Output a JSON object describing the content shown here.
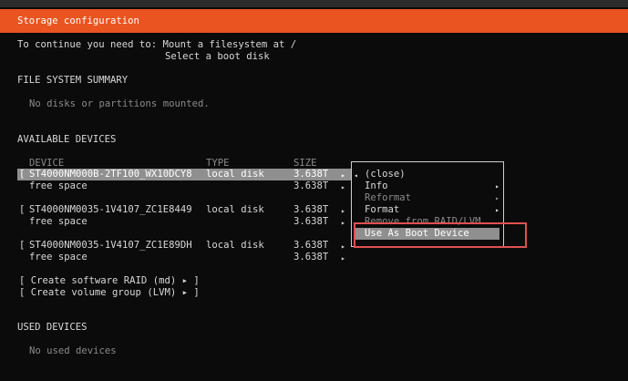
{
  "header": {
    "title": "Storage configuration"
  },
  "instructions": {
    "line1": "To continue you need to: Mount a filesystem at /",
    "line2": "Select a boot disk"
  },
  "fs_summary": {
    "heading": "FILE SYSTEM SUMMARY",
    "empty": "No disks or partitions mounted."
  },
  "available": {
    "heading": "AVAILABLE DEVICES",
    "columns": {
      "device": "DEVICE",
      "type": "TYPE",
      "size": "SIZE"
    },
    "devices": [
      {
        "bracket": "[",
        "name": "ST4000NM000B-2TF100_WX10DCY8",
        "type": "local disk",
        "size": "3.638T",
        "free_label": "free space",
        "free_size": "3.638T"
      },
      {
        "bracket": "[",
        "name": "ST4000NM0035-1V4107_ZC1E8449",
        "type": "local disk",
        "size": "3.638T",
        "free_label": "free space",
        "free_size": "3.638T"
      },
      {
        "bracket": "[",
        "name": "ST4000NM0035-1V4107_ZC1E89DH",
        "type": "local disk",
        "size": "3.638T",
        "free_label": "free space",
        "free_size": "3.638T"
      }
    ],
    "actions": [
      "[ Create software RAID (md) ▸ ]",
      "[ Create volume group (LVM) ▸ ]"
    ]
  },
  "context_menu": {
    "items": [
      {
        "label": "(close)",
        "submenu": false,
        "enabled": true,
        "selected": false
      },
      {
        "label": "Info",
        "submenu": true,
        "enabled": true,
        "selected": false
      },
      {
        "label": "Reformat",
        "submenu": true,
        "enabled": false,
        "selected": false
      },
      {
        "label": "Format",
        "submenu": true,
        "enabled": true,
        "selected": false
      },
      {
        "label": "Remove from RAID/LVM",
        "submenu": false,
        "enabled": false,
        "selected": false
      },
      {
        "label": "Use As Boot Device",
        "submenu": false,
        "enabled": true,
        "selected": true
      }
    ]
  },
  "used": {
    "heading": "USED DEVICES",
    "empty": "No used devices"
  },
  "colors": {
    "accent": "#e95420",
    "selection": "#8f8f8f",
    "annotation": "#e05050",
    "background": "#0b0b0b"
  }
}
